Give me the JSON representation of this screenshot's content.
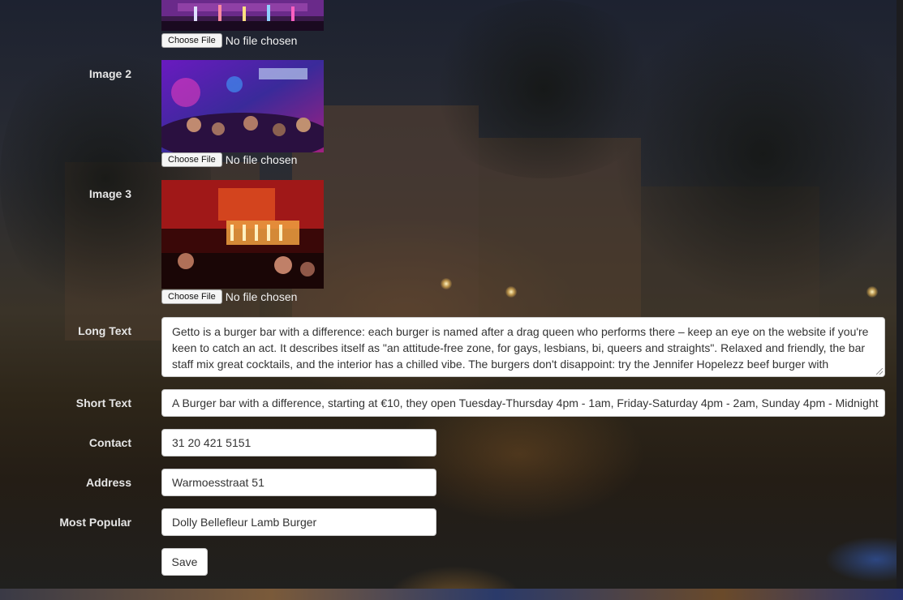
{
  "images": [
    {
      "label": "",
      "file_button": "Choose File",
      "file_status": "No file chosen",
      "scene": "bar-crowd-purple"
    },
    {
      "label": "Image 2",
      "file_button": "Choose File",
      "file_status": "No file chosen",
      "scene": "stage-crowd-purple-blue"
    },
    {
      "label": "Image 3",
      "file_button": "Choose File",
      "file_status": "No file chosen",
      "scene": "bar-interior-red"
    }
  ],
  "long_text": {
    "label": "Long Text",
    "value": "Getto is a burger bar with a difference: each burger is named after a drag queen who performs there – keep an eye on the website if you're keen to catch an act. It describes itself as \"an attitude-free zone, for gays, lesbians, bi, queers and straights\". Relaxed and friendly, the bar staff mix great cocktails, and the interior has a chilled vibe. The burgers don't disappoint: try the Jennifer Hopelezz beef burger with caramelised onions, or the Dolly Bellefleur lamb burger with tzatziki and grilled courgette. The dessert with the cheesecake and"
  },
  "short_text": {
    "label": "Short Text",
    "value": "A Burger bar with a difference, starting at €10, they open Tuesday-Thursday 4pm - 1am, Friday-Saturday 4pm - 2am, Sunday 4pm - Midnight"
  },
  "contact": {
    "label": "Contact",
    "value": "31 20 421 5151"
  },
  "address": {
    "label": "Address",
    "value": "Warmoesstraat 51"
  },
  "most_popular": {
    "label": "Most Popular",
    "value": "Dolly Bellefleur Lamb Burger"
  },
  "save_label": "Save",
  "colors": {
    "label_text": "#e6e6e6",
    "input_bg": "#ffffff",
    "input_border": "#cccccc"
  }
}
